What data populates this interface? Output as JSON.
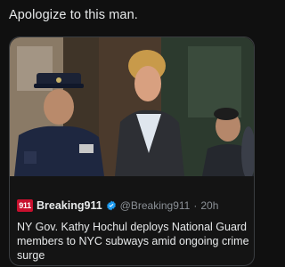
{
  "post": {
    "text": "Apologize to this man."
  },
  "quoted_post": {
    "avatar_text": "911",
    "display_name": "Breaking911",
    "handle": "@Breaking911",
    "separator": "·",
    "timestamp": "20h",
    "text": "NY Gov. Kathy Hochul deploys National Guard members to NYC subways amid ongoing crime surge",
    "verified_icon": "verified-badge-icon",
    "accent_color": "#1d9bf0",
    "avatar_color": "#c8102e"
  }
}
